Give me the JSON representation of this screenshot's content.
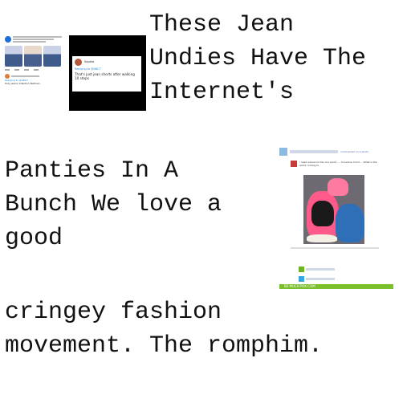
{
  "title": "These Jean\nUndies Have The\nInternet's",
  "body_1": "Panties In A\nBunch We love a\ngood",
  "body_2": "cringey fashion\nmovement. The romphim.",
  "tweet1": {
    "replying_to": "Replying to @ABC7",
    "reply": "Holy jeans! Infection Batman."
  },
  "tweet2": {
    "name": "Sophia",
    "replying_to": "Replying to @ABC7",
    "text": "That's just jean shorts after walking 10 steps"
  },
  "facebook": {
    "header": "commented on a photo",
    "comment": "i need wolves to the one world .... Converse Croct.... What is the world coming to",
    "footer": "BE MUCH POX.COM"
  }
}
